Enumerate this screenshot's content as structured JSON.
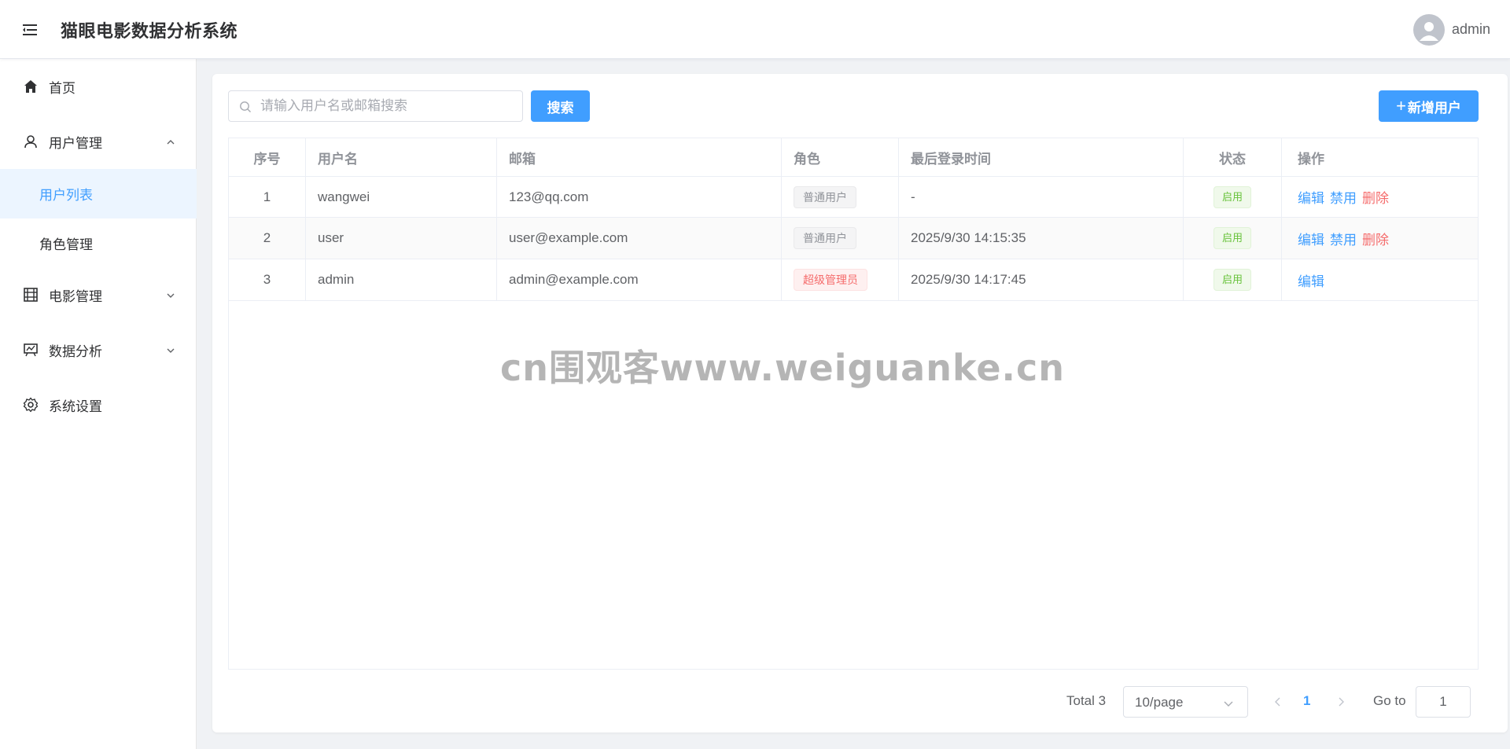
{
  "header": {
    "title": "猫眼电影数据分析系统",
    "username": "admin",
    "menu_icon": "menu-fold-icon",
    "avatar_icon": "user-avatar-icon"
  },
  "sidebar": {
    "items": [
      {
        "label": "首页",
        "icon": "home-icon"
      },
      {
        "label": "用户管理",
        "icon": "user-icon",
        "expanded": true
      },
      {
        "label": "用户列表",
        "active": true
      },
      {
        "label": "角色管理"
      },
      {
        "label": "电影管理",
        "icon": "film-icon",
        "expanded": false
      },
      {
        "label": "数据分析",
        "icon": "chart-icon",
        "expanded": false
      },
      {
        "label": "系统设置",
        "icon": "gear-icon"
      }
    ]
  },
  "toolbar": {
    "search_placeholder": "请输入用户名或邮箱搜索",
    "search_value": "",
    "search_button": "搜索",
    "add_plus": "+",
    "add_button": "新增用户"
  },
  "table": {
    "columns": [
      "序号",
      "用户名",
      "邮箱",
      "角色",
      "最后登录时间",
      "状态",
      "操作"
    ],
    "rows": [
      {
        "index": "1",
        "username": "wangwei",
        "email": "123@qq.com",
        "role": "普通用户",
        "role_type": "info",
        "last_login": "-",
        "status": "启用",
        "ops": [
          "编辑",
          "禁用",
          "删除"
        ]
      },
      {
        "index": "2",
        "username": "user",
        "email": "user@example.com",
        "role": "普通用户",
        "role_type": "info",
        "last_login": "2025/9/30 14:15:35",
        "status": "启用",
        "ops": [
          "编辑",
          "禁用",
          "删除"
        ]
      },
      {
        "index": "3",
        "username": "admin",
        "email": "admin@example.com",
        "role": "超级管理员",
        "role_type": "danger",
        "last_login": "2025/9/30 14:17:45",
        "status": "启用",
        "ops": [
          "编辑"
        ]
      }
    ]
  },
  "watermark": "cn围观客www.weiguanke.cn",
  "pagination": {
    "total": "Total 3",
    "page_size": "10/page",
    "current_page": "1",
    "goto_label": "Go to",
    "goto_value": "1"
  },
  "colors": {
    "primary": "#409eff",
    "danger": "#f56c6c",
    "success": "#67c23a",
    "sidebar_active_bg": "#ecf5ff"
  }
}
